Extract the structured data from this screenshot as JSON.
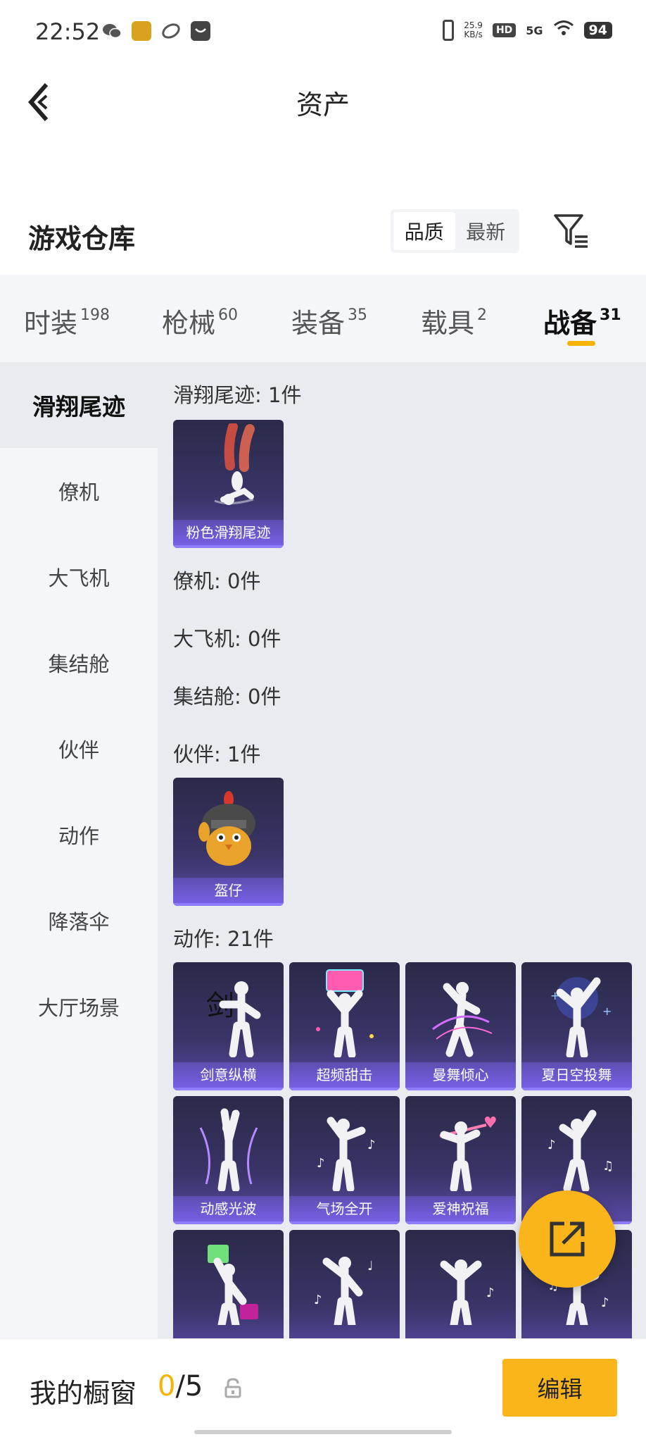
{
  "status_bar": {
    "time": "22:52",
    "network_speed": "25.9",
    "network_speed_unit": "KB/s",
    "hd": "HD",
    "signal": "5G",
    "battery": "94",
    "icons": [
      "wechat-icon",
      "game-app-icon",
      "link-app-icon",
      "message-app-icon",
      "vibrate-icon",
      "wifi-icon"
    ]
  },
  "header": {
    "title": "资产",
    "back_icon": "chevron-left-icon"
  },
  "warehouse": {
    "title": "游戏仓库",
    "sort_options": [
      "品质",
      "最新"
    ],
    "sort_active": "品质",
    "filter_icon": "filter-icon"
  },
  "tabs": [
    {
      "label": "时装",
      "count": "198"
    },
    {
      "label": "枪械",
      "count": "60"
    },
    {
      "label": "装备",
      "count": "35"
    },
    {
      "label": "载具",
      "count": "2"
    },
    {
      "label": "战备",
      "count": "31"
    }
  ],
  "active_tab": "战备",
  "side_nav": [
    "滑翔尾迹",
    "僚机",
    "大飞机",
    "集结舱",
    "伙伴",
    "动作",
    "降落伞",
    "大厅场景"
  ],
  "active_side": "滑翔尾迹",
  "sections": [
    {
      "label": "滑翔尾迹: 1件",
      "items": [
        "粉色滑翔尾迹"
      ]
    },
    {
      "label": "僚机: 0件",
      "items": []
    },
    {
      "label": "大飞机: 0件",
      "items": []
    },
    {
      "label": "集结舱: 0件",
      "items": []
    },
    {
      "label": "伙伴: 1件",
      "items": [
        "盔仔"
      ]
    },
    {
      "label": "动作: 21件",
      "items": [
        "剑意纵横",
        "超频甜击",
        "曼舞倾心",
        "夏日空投舞",
        "动感光波",
        "气场全开",
        "爱神祝福"
      ]
    }
  ],
  "bottom_bar": {
    "label": "我的橱窗",
    "current": "0",
    "total": "/5",
    "edit_label": "编辑"
  },
  "colors": {
    "accent": "#f9b51a",
    "card_bg": "#3a3468",
    "card_label": "#7860e6"
  }
}
